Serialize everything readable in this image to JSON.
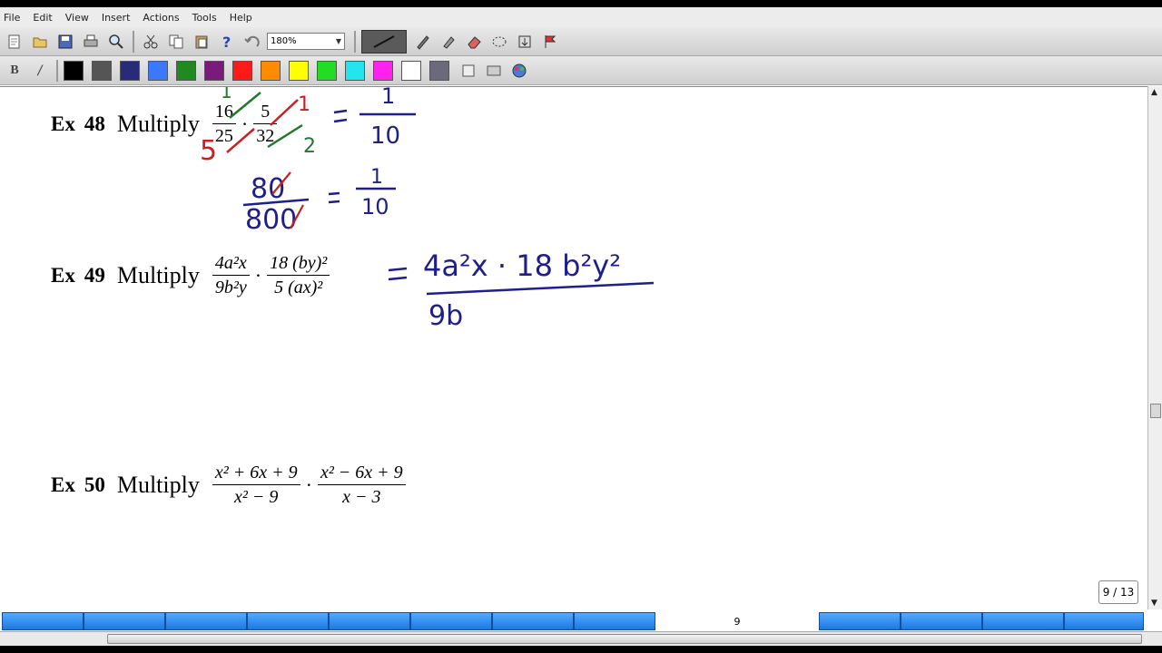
{
  "menu": [
    "File",
    "Edit",
    "View",
    "Insert",
    "Actions",
    "Tools",
    "Help"
  ],
  "toolbar": {
    "zoom": "180%",
    "icons": [
      "new-page-icon",
      "open-icon",
      "save-icon",
      "print-icon",
      "zoom-icon",
      "cut-icon",
      "copy-icon",
      "paste-icon",
      "help-icon",
      "undo-icon"
    ]
  },
  "palette": {
    "colors": [
      "#000000",
      "#555555",
      "#2a2a7a",
      "#3a78ff",
      "#1f8a1f",
      "#7a1a7a",
      "#ff1a1a",
      "#ff8c00",
      "#ffff00",
      "#22dd22",
      "#22e5ee",
      "#ff22ee",
      "#ffffff",
      "#6a6a7a"
    ]
  },
  "ink_colors": {
    "blue": "#1e1e8c",
    "green": "#1f7a2b",
    "red": "#cc1f1f"
  },
  "examples": [
    {
      "label": "Ex",
      "number": "48",
      "verb": "Multiply",
      "fractions": [
        {
          "num": "16",
          "den": "25"
        },
        {
          "num": "5",
          "den": "32"
        }
      ]
    },
    {
      "label": "Ex",
      "number": "49",
      "verb": "Multiply",
      "fractions": [
        {
          "num": "4a²x",
          "den": "9b²y"
        },
        {
          "num": "18 (by)²",
          "den": "5 (ax)²"
        }
      ]
    },
    {
      "label": "Ex",
      "number": "50",
      "verb": "Multiply",
      "fractions": [
        {
          "num": "x² + 6x + 9",
          "den": "x² − 9"
        },
        {
          "num": "x² − 6x + 9",
          "den": "x − 3"
        }
      ]
    }
  ],
  "handwriting": {
    "ex48_line1_result": {
      "num": "1",
      "den": "10"
    },
    "ex48_line2": {
      "num": "80",
      "den": "800",
      "eq_num": "1",
      "eq_den": "10"
    },
    "ex48_annotations": {
      "left_top": "1",
      "left_bottom": "5",
      "right_top": "1",
      "right_bottom": "2"
    },
    "ex49_work": {
      "num": "4a²x · 18 b²y²",
      "den": "9b"
    }
  },
  "pager": {
    "current": "9",
    "total": "13",
    "label": "9 / 13"
  },
  "page_tab": "9"
}
